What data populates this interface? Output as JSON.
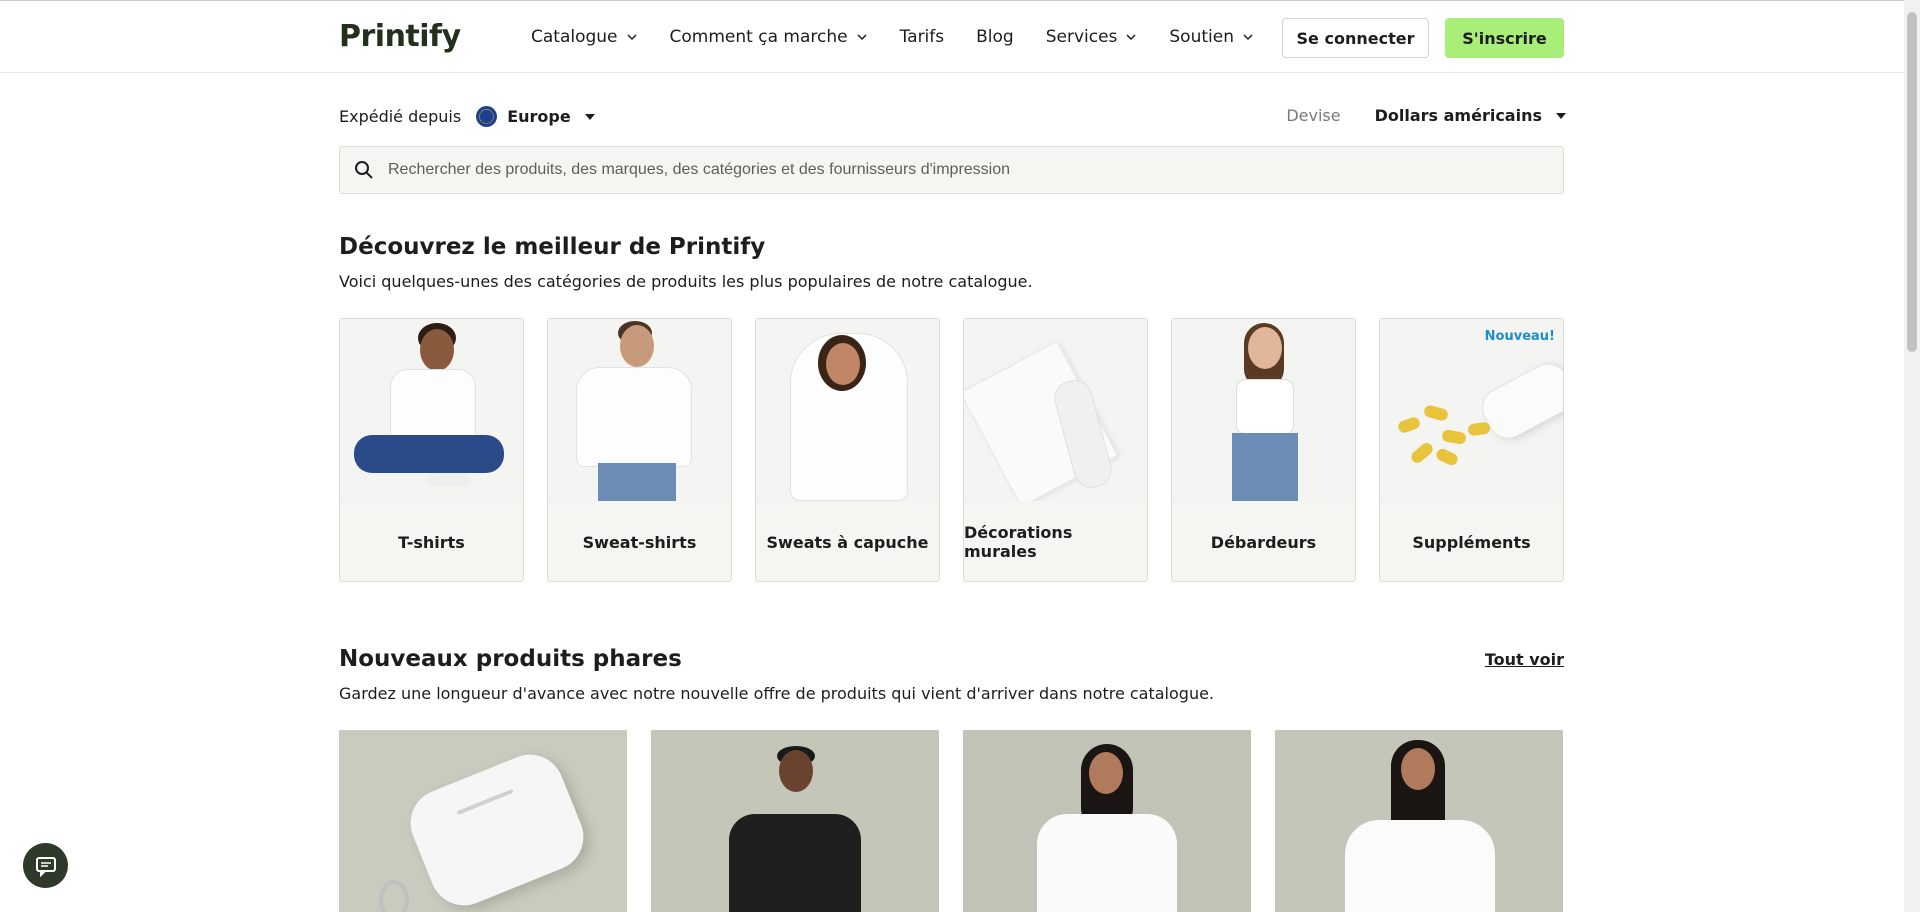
{
  "header": {
    "logo": "Printify",
    "nav": [
      {
        "label": "Catalogue",
        "dropdown": true
      },
      {
        "label": "Comment ça marche",
        "dropdown": true
      },
      {
        "label": "Tarifs",
        "dropdown": false
      },
      {
        "label": "Blog",
        "dropdown": false
      },
      {
        "label": "Services",
        "dropdown": true
      },
      {
        "label": "Soutien",
        "dropdown": true
      }
    ],
    "login_label": "Se connecter",
    "signup_label": "S'inscrire"
  },
  "shipping": {
    "label": "Expédié depuis",
    "value": "Europe"
  },
  "currency": {
    "label": "Devise",
    "value": "Dollars américains"
  },
  "search": {
    "placeholder": "Rechercher des produits, des marques, des catégories et des fournisseurs d'impression"
  },
  "discover": {
    "title": "Découvrez le meilleur de Printify",
    "subtitle": "Voici quelques-unes des catégories de produits les plus populaires de notre catalogue.",
    "categories": [
      {
        "label": "T-shirts"
      },
      {
        "label": "Sweat-shirts"
      },
      {
        "label": "Sweats à capuche"
      },
      {
        "label": "Décorations murales"
      },
      {
        "label": "Débardeurs"
      },
      {
        "label": "Suppléments",
        "badge": "Nouveau!"
      }
    ]
  },
  "new_products": {
    "title": "Nouveaux produits phares",
    "subtitle": "Gardez une longueur d'avance avec notre nouvelle offre de produits qui vient d'arriver dans notre catalogue.",
    "see_all": "Tout voir"
  },
  "colors": {
    "accent": "#a8ef7a",
    "badge": "#1d8fc7",
    "card_bg": "#f5f5f1"
  }
}
